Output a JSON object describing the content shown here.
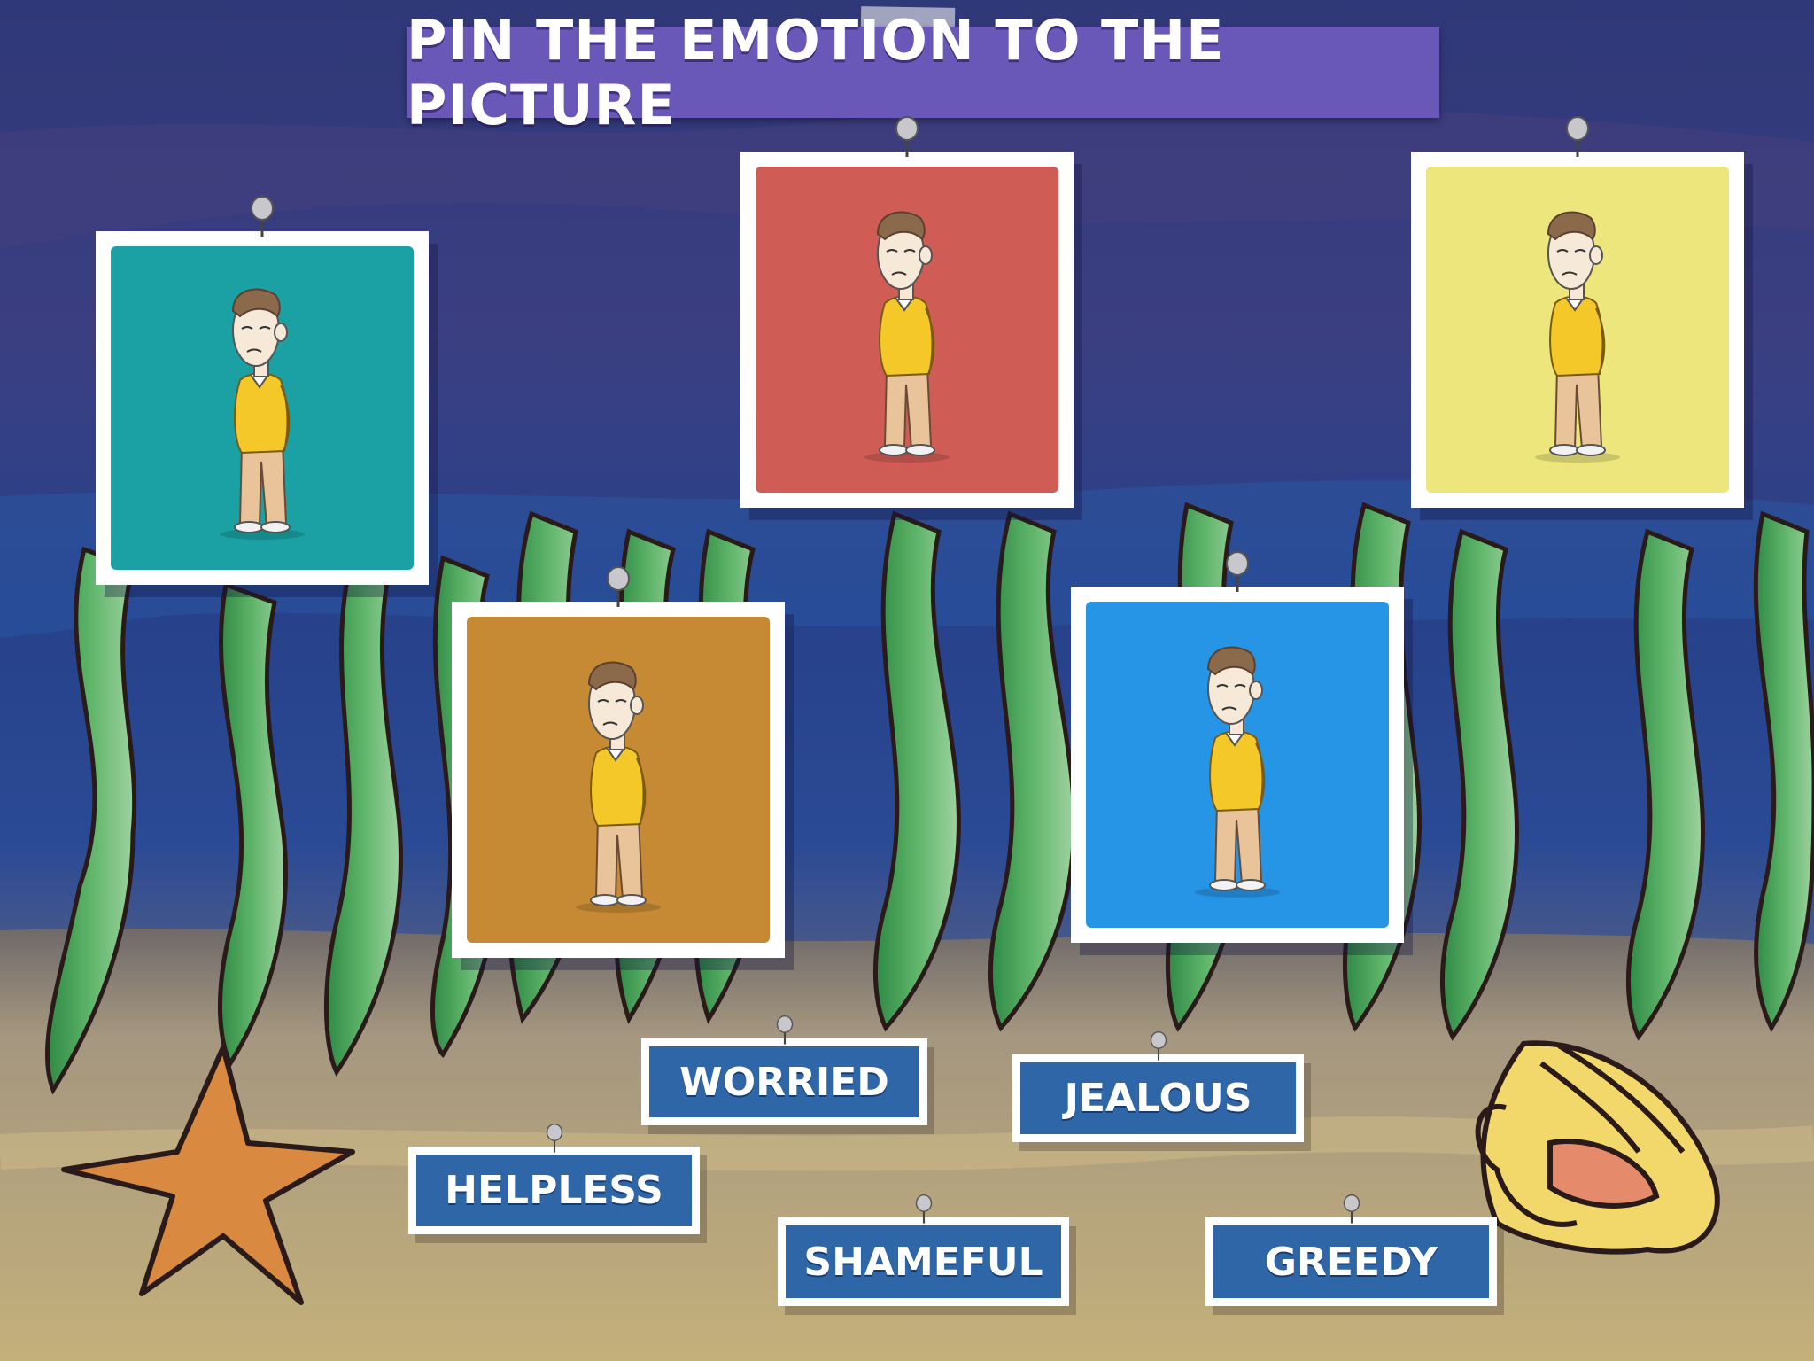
{
  "title": "PIN THE EMOTION TO THE PICTURE",
  "colors": {
    "banner": "#6a58b8",
    "label": "#2e66a8",
    "card_teal": "#1ba1a3",
    "card_red": "#d05c56",
    "card_yellow": "#ede67c",
    "card_orange": "#c68a35",
    "card_blue": "#2795e6"
  },
  "pictures": [
    {
      "name": "picture-teal",
      "color": "#1ba1a3"
    },
    {
      "name": "picture-red",
      "color": "#d05c56"
    },
    {
      "name": "picture-yellow",
      "color": "#ede67c"
    },
    {
      "name": "picture-orange",
      "color": "#c68a35"
    },
    {
      "name": "picture-blue",
      "color": "#2795e6"
    }
  ],
  "emotions": [
    "WORRIED",
    "JEALOUS",
    "HELPLESS",
    "SHAMEFUL",
    "GREEDY"
  ],
  "decorations": [
    "starfish-icon",
    "seashell-icon",
    "seaweed-icon",
    "pushpin-icon"
  ]
}
